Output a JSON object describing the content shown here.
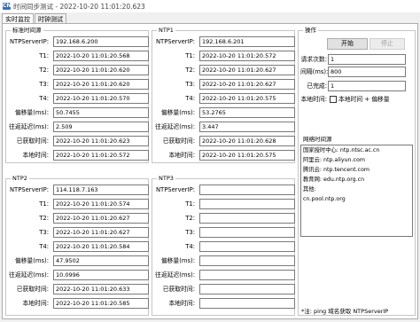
{
  "window": {
    "title": "时间同步测试 - 2022-10-20 11:01:20.623",
    "icon": "CN"
  },
  "tabs": [
    {
      "label": "实时监控"
    },
    {
      "label": "时钟测试"
    }
  ],
  "labels": {
    "server": "NTPServerIP:",
    "t1": "T1:",
    "t2": "T2:",
    "t3": "T3:",
    "t4": "T4:",
    "offset": "偏移量(ms):",
    "delay": "往返延迟(ms):",
    "obtained": "已获取时间:",
    "local": "本地时间:"
  },
  "groups": {
    "standard": {
      "title": "标准时间源",
      "server": "192.168.6.200",
      "t1": "2022-10-20 11:01:20.568",
      "t2": "2022-10-20 11:01:20.620",
      "t3": "2022-10-20 11:01:20.620",
      "t4": "2022-10-20 11:01:20.570",
      "offset": "50.7455",
      "delay": "2.509",
      "obtained": "2022-10-20 11:01:20.623",
      "local": "2022-10-20 11:01:20.572"
    },
    "ntp1": {
      "title": "NTP1",
      "server": "192.168.6.201",
      "t1": "2022-10-20 11:01:20.572",
      "t2": "2022-10-20 11:01:20.627",
      "t3": "2022-10-20 11:01:20.627",
      "t4": "2022-10-20 11:01:20.575",
      "offset": "53.2765",
      "delay": "3.447",
      "obtained": "2022-10-20 11:01:20.628",
      "local": "2022-10-20 11:01:20.575"
    },
    "ntp2": {
      "title": "NTP2",
      "server": "114.118.7.163",
      "t1": "2022-10-20 11:01:20.574",
      "t2": "2022-10-20 11:01:20.627",
      "t3": "2022-10-20 11:01:20.627",
      "t4": "2022-10-20 11:01:20.584",
      "offset": "47.9502",
      "delay": "10.0996",
      "obtained": "2022-10-20 11:01:20.633",
      "local": "2022-10-20 11:01:20.585"
    },
    "ntp3": {
      "title": "NTP3",
      "server": "",
      "t1": "",
      "t2": "",
      "t3": "",
      "t4": "",
      "offset": "",
      "delay": "",
      "obtained": "",
      "local": ""
    }
  },
  "ops": {
    "title": "操作",
    "start_label": "开始",
    "stop_label": "停止",
    "requests_label": "请求次数:",
    "requests_value": "1",
    "interval_label": "间隔(ms):",
    "interval_value": "800",
    "completed_label": "已完成:",
    "completed_value": "1",
    "localtime_label": "本地时间:",
    "localtime_check_label": "本地时间 + 偏移量",
    "localtime_checked": false
  },
  "network": {
    "title": "网络时间源",
    "items": [
      "国家授时中心: ntp.ntsc.ac.cn",
      "阿里云: ntp.aliyun.com",
      "腾讯云: ntp.tencent.com",
      "教育网: edu.ntp.org.cn",
      "其他:",
      "cn.pool.ntp.org"
    ]
  },
  "note": "*注: ping 域名获取 NTPServerIP"
}
